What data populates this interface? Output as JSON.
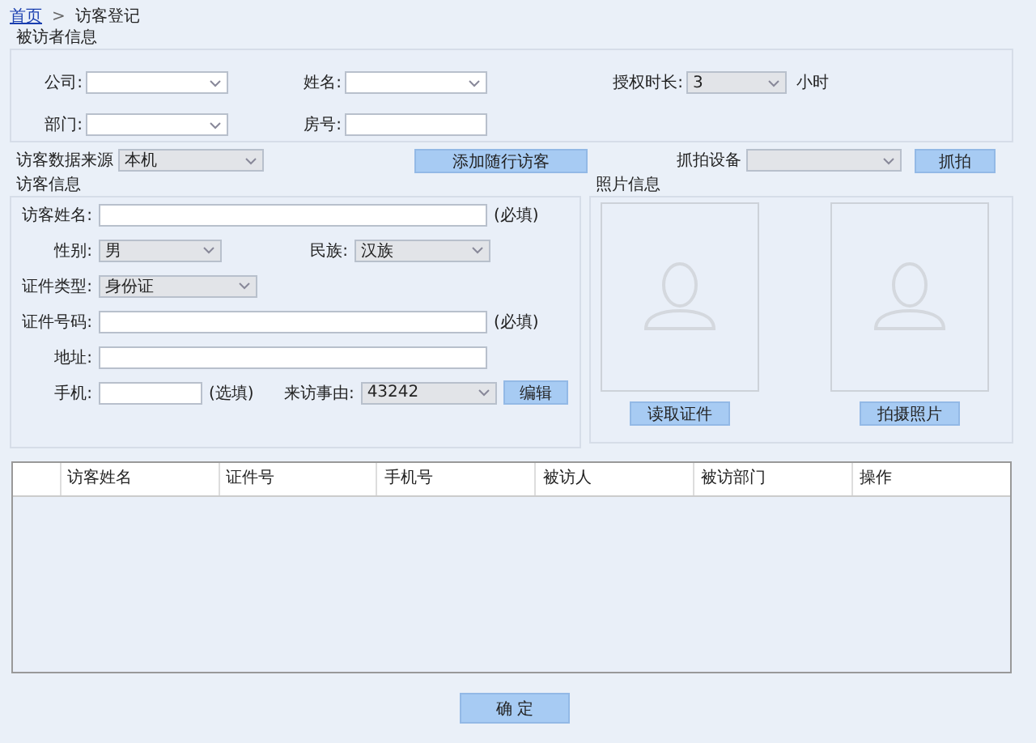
{
  "breadcrumb": {
    "home": "首页",
    "separator": ">",
    "current": "访客登记"
  },
  "visitee": {
    "title": "被访者信息",
    "fields": [
      {
        "label": "公司:",
        "kind": "select"
      },
      {
        "label": "姓名:",
        "kind": "select"
      },
      {
        "label": "授权时长:",
        "kind": "select",
        "value": "3",
        "unit": "小时"
      },
      {
        "label": "部门:",
        "kind": "select"
      },
      {
        "label": "房号:",
        "kind": "input"
      }
    ]
  },
  "source": {
    "label": "访客数据来源",
    "value": "本机"
  },
  "add_button": "添加随行访客",
  "capture_device": {
    "label": "抓拍设备"
  },
  "capture_button": "抓拍",
  "visitor": {
    "title": "访客信息",
    "rows": [
      [
        {
          "label": "访客姓名:",
          "kind": "input",
          "note": "(必填)"
        }
      ],
      [
        {
          "label": "性别:",
          "kind": "select",
          "value": "男"
        },
        {
          "label": "民族:",
          "kind": "select",
          "value": "汉族"
        }
      ],
      [
        {
          "label": "证件类型:",
          "kind": "select",
          "value": "身份证"
        }
      ],
      [
        {
          "label": "证件号码:",
          "kind": "input",
          "note": "(必填)"
        }
      ],
      [
        {
          "label": "地址:",
          "kind": "input"
        }
      ],
      [
        {
          "label": "手机:",
          "kind": "input",
          "note": "(选填)"
        },
        {
          "label": "来访事由:",
          "kind": "select",
          "value": "43242"
        },
        {
          "kind": "button",
          "label": "编辑"
        }
      ]
    ]
  },
  "photo": {
    "title": "照片信息",
    "slots": [
      {
        "button": "读取证件"
      },
      {
        "button": "拍摄照片"
      }
    ]
  },
  "table": {
    "columns": [
      "访客姓名",
      "证件号",
      "手机号",
      "被访人",
      "被访部门",
      "操作"
    ]
  },
  "confirm_button": "确 定"
}
